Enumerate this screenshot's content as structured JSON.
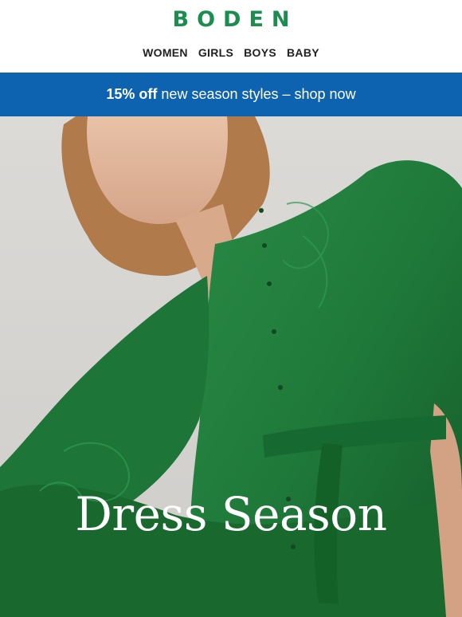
{
  "header": {
    "logo": "BODEN",
    "nav": [
      "WOMEN",
      "GIRLS",
      "BOYS",
      "BABY"
    ]
  },
  "promo": {
    "strong": "15% off",
    "text": "new season styles – shop now"
  },
  "hero": {
    "title": "Dress Season",
    "image_icon": "model-green-dress-photo"
  },
  "colors": {
    "brand_green": "#1a8d4f",
    "promo_blue": "#0e63b0",
    "dress_green": "#1f7a3a"
  }
}
